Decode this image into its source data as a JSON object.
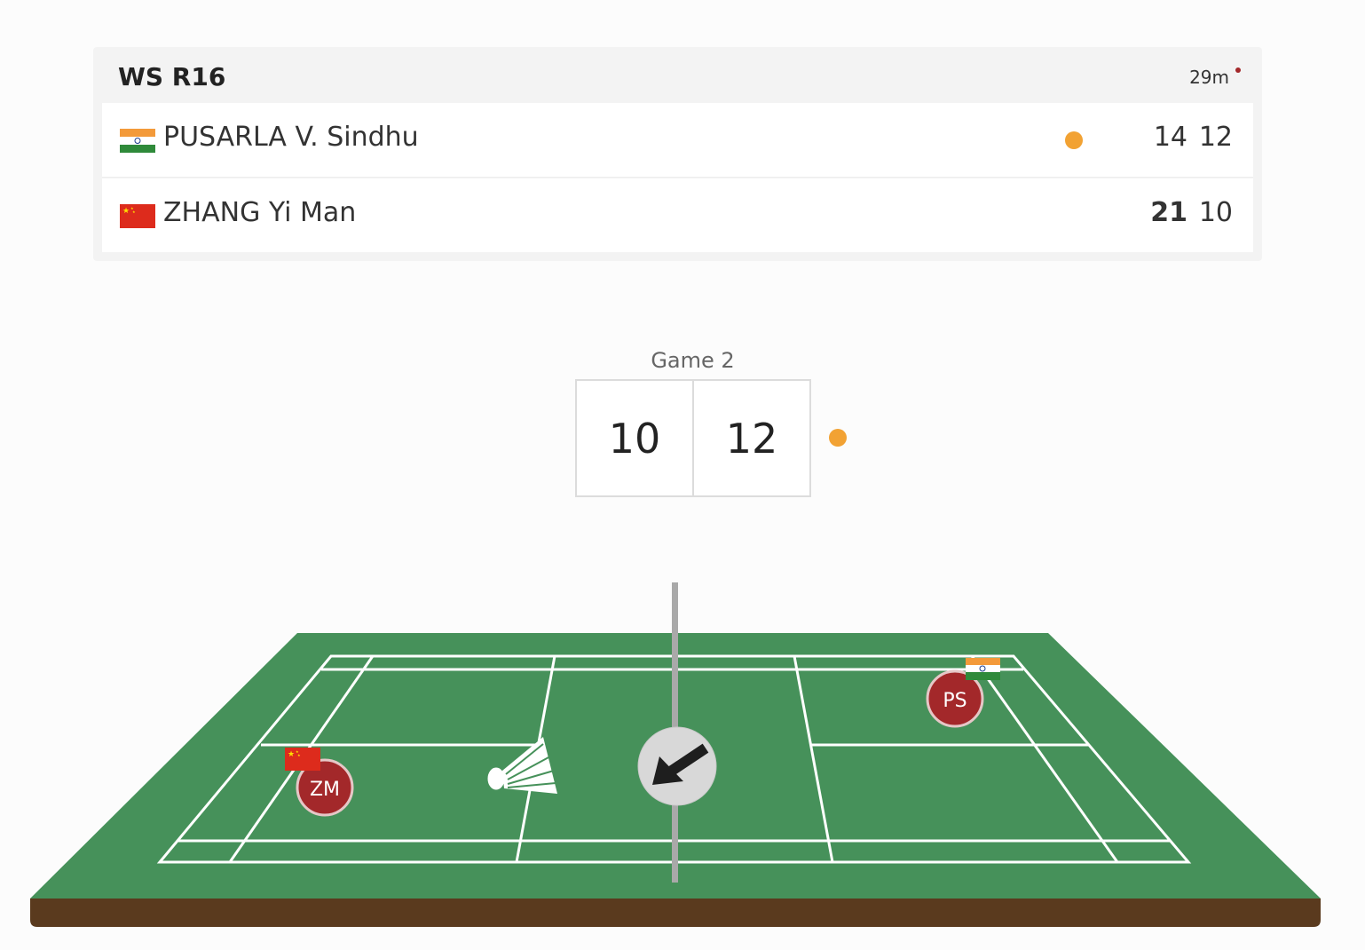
{
  "match": {
    "title": "WS R16",
    "duration": "29m",
    "live_indicator_color": "#a3282a"
  },
  "players": [
    {
      "name": "PUSARLA V. Sindhu",
      "country_flag": "india-flag-icon",
      "serving": true,
      "games": [
        "14",
        "12"
      ],
      "initials": "PS"
    },
    {
      "name": "ZHANG Yi Man",
      "country_flag": "china-flag-icon",
      "serving": false,
      "games": [
        "21",
        "10"
      ],
      "initials": "ZM"
    }
  ],
  "current_game": {
    "label": "Game 2",
    "left_score": "10",
    "right_score": "12",
    "serve_indicator_color": "#f2a233"
  },
  "court": {
    "surface_color": "#46915a",
    "base_color": "#5a3a1e",
    "line_color": "#ffffff",
    "direction_icon": "arrow-down-left-icon",
    "shuttle_icon": "shuttlecock-icon"
  }
}
